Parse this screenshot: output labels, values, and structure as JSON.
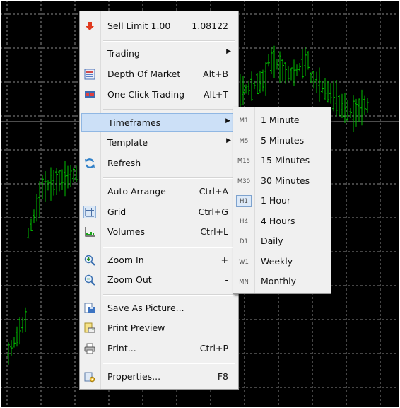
{
  "context_menu": {
    "items": [
      {
        "label": "Sell Limit 1.00",
        "shortcut": "1.08122",
        "icon": "red-down-arrow-icon"
      },
      {
        "label": "Trading",
        "shortcut": "",
        "icon": "",
        "submenu": true
      },
      {
        "label": "Depth Of Market",
        "shortcut": "Alt+B",
        "icon": "depth-of-market-icon"
      },
      {
        "label": "One Click Trading",
        "shortcut": "Alt+T",
        "icon": "one-click-trading-icon"
      },
      {
        "label": "Timeframes",
        "shortcut": "",
        "icon": "",
        "submenu": true,
        "highlighted": true
      },
      {
        "label": "Template",
        "shortcut": "",
        "icon": "",
        "submenu": true
      },
      {
        "label": "Refresh",
        "shortcut": "",
        "icon": "refresh-icon"
      },
      {
        "label": "Auto Arrange",
        "shortcut": "Ctrl+A",
        "icon": ""
      },
      {
        "label": "Grid",
        "shortcut": "Ctrl+G",
        "icon": "grid-icon"
      },
      {
        "label": "Volumes",
        "shortcut": "Ctrl+L",
        "icon": "volumes-icon"
      },
      {
        "label": "Zoom In",
        "shortcut": "+",
        "icon": "zoom-in-icon"
      },
      {
        "label": "Zoom Out",
        "shortcut": "-",
        "icon": "zoom-out-icon"
      },
      {
        "label": "Save As Picture...",
        "shortcut": "",
        "icon": "save-picture-icon"
      },
      {
        "label": "Print Preview",
        "shortcut": "",
        "icon": "print-preview-icon"
      },
      {
        "label": "Print...",
        "shortcut": "Ctrl+P",
        "icon": "printer-icon"
      },
      {
        "label": "Properties...",
        "shortcut": "F8",
        "icon": "properties-icon"
      }
    ]
  },
  "timeframes_submenu": {
    "items": [
      {
        "code": "M1",
        "label": "1 Minute"
      },
      {
        "code": "M5",
        "label": "5 Minutes"
      },
      {
        "code": "M15",
        "label": "15 Minutes"
      },
      {
        "code": "M30",
        "label": "30 Minutes"
      },
      {
        "code": "H1",
        "label": "1 Hour",
        "checked": true
      },
      {
        "code": "H4",
        "label": "4 Hours"
      },
      {
        "code": "D1",
        "label": "Daily"
      },
      {
        "code": "W1",
        "label": "Weekly"
      },
      {
        "code": "MN",
        "label": "Monthly"
      }
    ]
  },
  "colors": {
    "chart_background": "#000000",
    "bars": "#00c000",
    "grid": "#8a8a8a",
    "menu_background": "#f0f0f0",
    "highlight": "#cce0f7",
    "sell_arrow": "#e03a1e"
  }
}
